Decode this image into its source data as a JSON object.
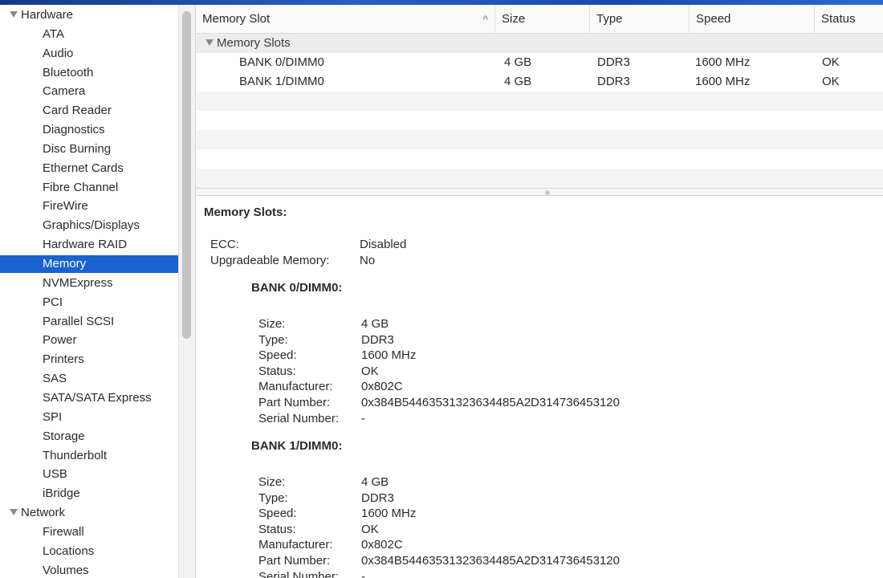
{
  "sidebar": {
    "categories": [
      {
        "label": "Hardware",
        "items": [
          "ATA",
          "Audio",
          "Bluetooth",
          "Camera",
          "Card Reader",
          "Diagnostics",
          "Disc Burning",
          "Ethernet Cards",
          "Fibre Channel",
          "FireWire",
          "Graphics/Displays",
          "Hardware RAID",
          "Memory",
          "NVMExpress",
          "PCI",
          "Parallel SCSI",
          "Power",
          "Printers",
          "SAS",
          "SATA/SATA Express",
          "SPI",
          "Storage",
          "Thunderbolt",
          "USB",
          "iBridge"
        ]
      },
      {
        "label": "Network",
        "items": [
          "Firewall",
          "Locations",
          "Volumes"
        ]
      }
    ],
    "selected": "Memory"
  },
  "table": {
    "columns": [
      "Memory Slot",
      "Size",
      "Type",
      "Speed",
      "Status"
    ],
    "sort_indicator": "^",
    "group_label": "Memory Slots",
    "rows": [
      [
        "BANK 0/DIMM0",
        "4 GB",
        "DDR3",
        "1600 MHz",
        "OK"
      ],
      [
        "BANK 1/DIMM0",
        "4 GB",
        "DDR3",
        "1600 MHz",
        "OK"
      ]
    ]
  },
  "detail": {
    "title": "Memory Slots:",
    "summary": [
      {
        "k": "ECC:",
        "v": "Disabled"
      },
      {
        "k": "Upgradeable Memory:",
        "v": "No"
      }
    ],
    "banks": [
      {
        "title": "BANK 0/DIMM0:",
        "fields": [
          {
            "k": "Size:",
            "v": "4 GB"
          },
          {
            "k": "Type:",
            "v": "DDR3"
          },
          {
            "k": "Speed:",
            "v": "1600 MHz"
          },
          {
            "k": "Status:",
            "v": "OK"
          },
          {
            "k": "Manufacturer:",
            "v": "0x802C"
          },
          {
            "k": "Part Number:",
            "v": "0x384B54463531323634485A2D314736453120"
          },
          {
            "k": "Serial Number:",
            "v": "-"
          }
        ]
      },
      {
        "title": "BANK 1/DIMM0:",
        "fields": [
          {
            "k": "Size:",
            "v": "4 GB"
          },
          {
            "k": "Type:",
            "v": "DDR3"
          },
          {
            "k": "Speed:",
            "v": "1600 MHz"
          },
          {
            "k": "Status:",
            "v": "OK"
          },
          {
            "k": "Manufacturer:",
            "v": "0x802C"
          },
          {
            "k": "Part Number:",
            "v": "0x384B54463531323634485A2D314736453120"
          },
          {
            "k": "Serial Number:",
            "v": "-"
          }
        ]
      }
    ]
  },
  "colors": {
    "selection": "#1a62cf",
    "desktop": "#1d3f8a"
  }
}
